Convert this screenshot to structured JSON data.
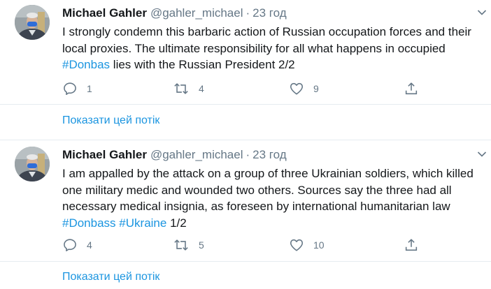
{
  "tweets": [
    {
      "author_name": "Michael Gahler",
      "author_handle": "@gahler_michael",
      "separator": "·",
      "time": "23 год",
      "text_parts": [
        "I strongly condemn this barbaric action of Russian occupation forces and their local proxies. The ultimate responsibility for all what happens in occupied ",
        "#Donbas",
        " lies with the Russian President 2/2"
      ],
      "replies": "1",
      "retweets": "4",
      "likes": "9",
      "show_thread": "Показати цей потік"
    },
    {
      "author_name": "Michael Gahler",
      "author_handle": "@gahler_michael",
      "separator": "·",
      "time": "23 год",
      "text_parts": [
        "I am appalled by the attack on a group of three Ukrainian soldiers, which killed one military medic and wounded two others. Sources say the three had all necessary medical insignia, as foreseen by international humanitarian law ",
        "#Donbass",
        " ",
        "#Ukraine",
        " 1/2"
      ],
      "replies": "4",
      "retweets": "5",
      "likes": "10",
      "show_thread": "Показати цей потік"
    }
  ],
  "icons": {
    "reply": "reply-icon",
    "retweet": "retweet-icon",
    "like": "like-icon",
    "share": "share-icon",
    "caret": "chevron-down-icon"
  },
  "colors": {
    "accent": "#1b95e0",
    "secondary_text": "#657786",
    "primary_text": "#14171a",
    "divider": "#e6ecf0"
  }
}
